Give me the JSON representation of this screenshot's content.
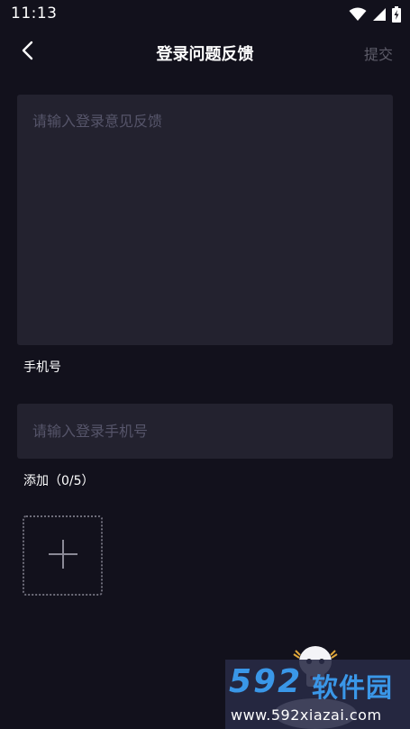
{
  "status_bar": {
    "time": "11:13",
    "icons": [
      "wifi-icon",
      "signal-icon",
      "battery-charging-icon"
    ]
  },
  "header": {
    "title": "登录问题反馈",
    "submit_label": "提交",
    "back_icon": "chevron-left-icon"
  },
  "feedback": {
    "placeholder": "请输入登录意见反馈",
    "value": ""
  },
  "phone": {
    "label": "手机号",
    "placeholder": "请输入登录手机号",
    "value": ""
  },
  "attachments": {
    "label": "添加（0/5）",
    "add_icon": "plus-icon"
  },
  "watermark": {
    "brand_number": "592",
    "brand_text": "软件园",
    "url": "www.592xiazai.com"
  },
  "colors": {
    "background": "#12111c",
    "input_background": "#23222f",
    "placeholder": "#56556a",
    "disabled_text": "#5e5d6a",
    "watermark_blue": "#3a97e8"
  }
}
